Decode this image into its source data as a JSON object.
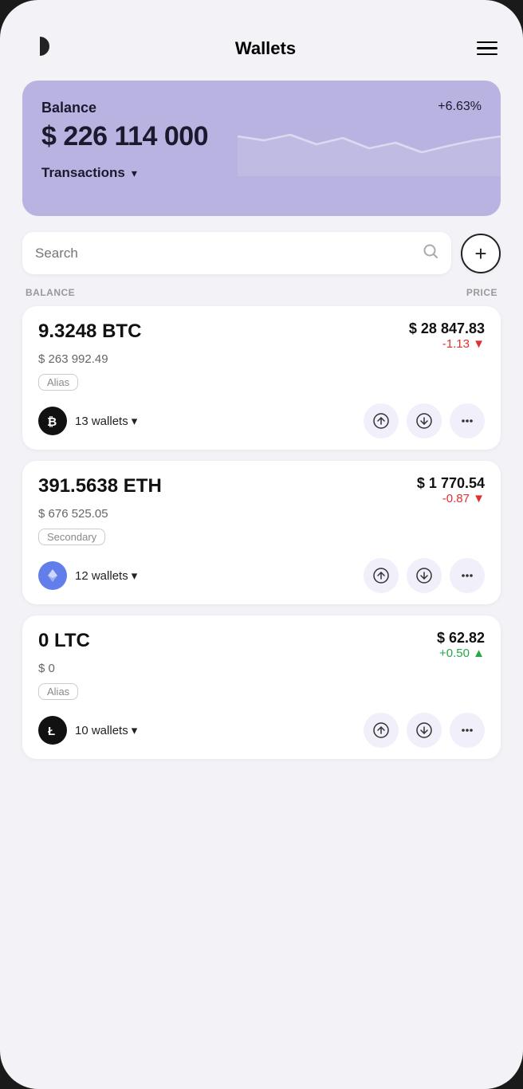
{
  "header": {
    "title": "Wallets",
    "menu_label": "menu"
  },
  "balance_card": {
    "label": "Balance",
    "percent": "+6.63%",
    "amount": "$ 226 114 000",
    "transactions_label": "Transactions"
  },
  "search": {
    "placeholder": "Search"
  },
  "add_button": "+",
  "columns": {
    "balance": "BALANCE",
    "price": "PRICE"
  },
  "coins": [
    {
      "amount": "9.3248 BTC",
      "usd_value": "$ 263 992.49",
      "tag": "Alias",
      "wallets": "13 wallets",
      "price": "$ 28 847.83",
      "change": "-1.13",
      "change_sign": "neg",
      "symbol": "BTC",
      "logo_char": "₿"
    },
    {
      "amount": "391.5638 ETH",
      "usd_value": "$ 676 525.05",
      "tag": "Secondary",
      "wallets": "12 wallets",
      "price": "$ 1 770.54",
      "change": "-0.87",
      "change_sign": "neg",
      "symbol": "ETH",
      "logo_char": "⬡"
    },
    {
      "amount": "0 LTC",
      "usd_value": "$ 0",
      "tag": "Alias",
      "wallets": "10 wallets",
      "price": "$ 62.82",
      "change": "+0.50",
      "change_sign": "pos",
      "symbol": "LTC",
      "logo_char": "Ł"
    }
  ]
}
